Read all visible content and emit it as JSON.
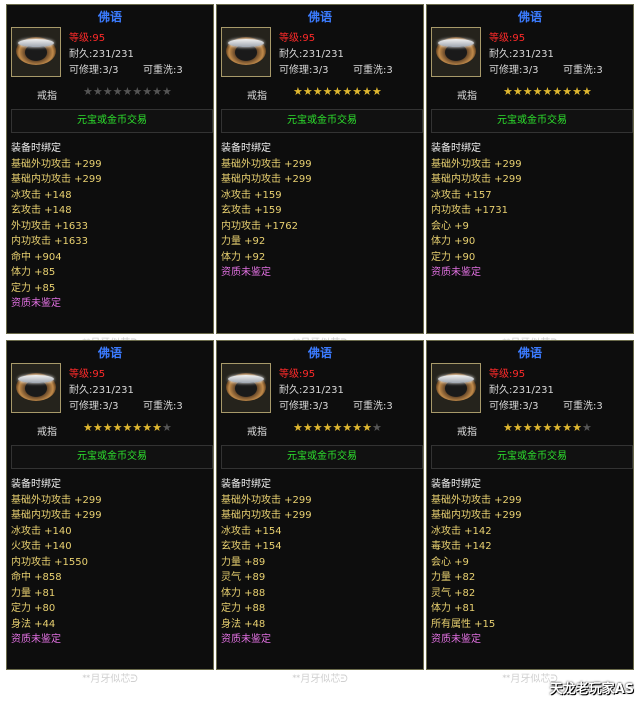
{
  "cards": [
    {
      "title": "佛语",
      "level": "等级:95",
      "durability": "耐久:231/231",
      "repair": "可修理:3/3",
      "rewash": "可重洗:3",
      "type": "戒指",
      "stars": 0,
      "trade": "元宝或金币交易",
      "bind": "装备时绑定",
      "attrs": [
        "基础外功攻击 +299",
        "基础内功攻击 +299",
        "冰攻击 +148",
        "玄攻击 +148",
        "外功攻击 +1633",
        "内功攻击 +1633",
        "命中 +904",
        "体力 +85",
        "定力 +85"
      ],
      "quality": "资质未鉴定",
      "footer": "月牙似芯"
    },
    {
      "title": "佛语",
      "level": "等级:95",
      "durability": "耐久:231/231",
      "repair": "可修理:3/3",
      "rewash": "可重洗:3",
      "type": "戒指",
      "stars": 9,
      "trade": "元宝或金币交易",
      "bind": "装备时绑定",
      "attrs": [
        "基础外功攻击 +299",
        "基础内功攻击 +299",
        "冰攻击 +159",
        "玄攻击 +159",
        "内功攻击 +1762",
        "力量 +92",
        "体力 +92"
      ],
      "quality": "资质未鉴定",
      "footer": "月牙似芯"
    },
    {
      "title": "佛语",
      "level": "等级:95",
      "durability": "耐久:231/231",
      "repair": "可修理:3/3",
      "rewash": "可重洗:3",
      "type": "戒指",
      "stars": 9,
      "trade": "元宝或金币交易",
      "bind": "装备时绑定",
      "attrs": [
        "基础外功攻击 +299",
        "基础内功攻击 +299",
        "冰攻击 +157",
        "内功攻击 +1731",
        "会心 +9",
        "体力 +90",
        "定力 +90"
      ],
      "quality": "资质未鉴定",
      "footer": "月牙似芯"
    },
    {
      "title": "佛语",
      "level": "等级:95",
      "durability": "耐久:231/231",
      "repair": "可修理:3/3",
      "rewash": "可重洗:3",
      "type": "戒指",
      "stars": 8,
      "trade": "元宝或金币交易",
      "bind": "装备时绑定",
      "attrs": [
        "基础外功攻击 +299",
        "基础内功攻击 +299",
        "冰攻击 +140",
        "火攻击 +140",
        "内功攻击 +1550",
        "命中 +858",
        "力量 +81",
        "定力 +80",
        "身法 +44"
      ],
      "quality": "资质未鉴定",
      "footer": "月牙似芯"
    },
    {
      "title": "佛语",
      "level": "等级:95",
      "durability": "耐久:231/231",
      "repair": "可修理:3/3",
      "rewash": "可重洗:3",
      "type": "戒指",
      "stars": 8,
      "trade": "元宝或金币交易",
      "bind": "装备时绑定",
      "attrs": [
        "基础外功攻击 +299",
        "基础内功攻击 +299",
        "冰攻击 +154",
        "玄攻击 +154",
        "力量 +89",
        "灵气 +89",
        "体力 +88",
        "定力 +88",
        "身法 +48"
      ],
      "quality": "资质未鉴定",
      "footer": "月牙似芯"
    },
    {
      "title": "佛语",
      "level": "等级:95",
      "durability": "耐久:231/231",
      "repair": "可修理:3/3",
      "rewash": "可重洗:3",
      "type": "戒指",
      "stars": 8,
      "trade": "元宝或金币交易",
      "bind": "装备时绑定",
      "attrs": [
        "基础外功攻击 +299",
        "基础内功攻击 +299",
        "冰攻击 +142",
        "毒攻击 +142",
        "会心 +9",
        "力量 +82",
        "灵气 +82",
        "体力 +81",
        "所有属性 +15"
      ],
      "quality": "资质未鉴定",
      "footer": "月牙似芯"
    }
  ],
  "watermark": "天龙老玩家AS",
  "star_total": 9,
  "colors": {
    "title": "#3b7bff",
    "level": "#ff2a2a",
    "trade": "#2de02d",
    "attr": "#e8d070",
    "quality": "#e070e0",
    "star": "#e0b830"
  }
}
